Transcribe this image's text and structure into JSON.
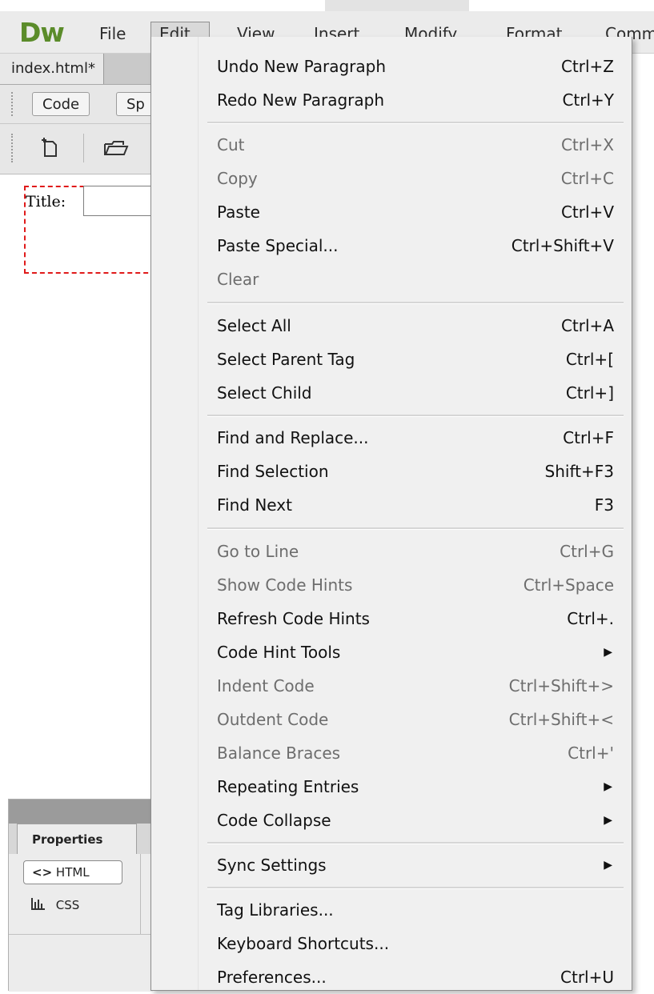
{
  "app": {
    "logo": "Dw"
  },
  "menubar": {
    "items": [
      "File",
      "Edit",
      "View",
      "Insert",
      "Modify",
      "Format",
      "Comm"
    ]
  },
  "document": {
    "tab_label": "index.html*",
    "view_buttons": [
      "Code",
      "Sp"
    ],
    "form_label": "Title:"
  },
  "properties": {
    "tab_label": "Properties",
    "html_button": "HTML",
    "html_glyph": "<>",
    "css_button": "CSS"
  },
  "edit_menu": {
    "items": [
      {
        "label": "Undo New Paragraph",
        "shortcut": "Ctrl+Z",
        "enabled": true
      },
      {
        "label": "Redo New Paragraph",
        "shortcut": "Ctrl+Y",
        "enabled": true
      },
      {
        "label": "Cut",
        "shortcut": "Ctrl+X",
        "enabled": false
      },
      {
        "label": "Copy",
        "shortcut": "Ctrl+C",
        "enabled": false
      },
      {
        "label": "Paste",
        "shortcut": "Ctrl+V",
        "enabled": true
      },
      {
        "label": "Paste Special...",
        "shortcut": "Ctrl+Shift+V",
        "enabled": true
      },
      {
        "label": "Clear",
        "shortcut": "",
        "enabled": false
      },
      {
        "label": "Select All",
        "shortcut": "Ctrl+A",
        "enabled": true
      },
      {
        "label": "Select Parent Tag",
        "shortcut": "Ctrl+[",
        "enabled": true
      },
      {
        "label": "Select Child",
        "shortcut": "Ctrl+]",
        "enabled": true
      },
      {
        "label": "Find and Replace...",
        "shortcut": "Ctrl+F",
        "enabled": true
      },
      {
        "label": "Find Selection",
        "shortcut": "Shift+F3",
        "enabled": true
      },
      {
        "label": "Find Next",
        "shortcut": "F3",
        "enabled": true
      },
      {
        "label": "Go to Line",
        "shortcut": "Ctrl+G",
        "enabled": false
      },
      {
        "label": "Show Code Hints",
        "shortcut": "Ctrl+Space",
        "enabled": false
      },
      {
        "label": "Refresh Code Hints",
        "shortcut": "Ctrl+.",
        "enabled": true
      },
      {
        "label": "Code Hint Tools",
        "shortcut": "",
        "enabled": true,
        "submenu": true
      },
      {
        "label": "Indent Code",
        "shortcut": "Ctrl+Shift+>",
        "enabled": false
      },
      {
        "label": "Outdent Code",
        "shortcut": "Ctrl+Shift+<",
        "enabled": false
      },
      {
        "label": "Balance Braces",
        "shortcut": "Ctrl+'",
        "enabled": false
      },
      {
        "label": "Repeating Entries",
        "shortcut": "",
        "enabled": true,
        "submenu": true
      },
      {
        "label": "Code Collapse",
        "shortcut": "",
        "enabled": true,
        "submenu": true
      },
      {
        "label": "Sync Settings",
        "shortcut": "",
        "enabled": true,
        "submenu": true
      },
      {
        "label": "Tag Libraries...",
        "shortcut": "",
        "enabled": true
      },
      {
        "label": "Keyboard Shortcuts...",
        "shortcut": "",
        "enabled": true
      },
      {
        "label": "Preferences...",
        "shortcut": "Ctrl+U",
        "enabled": true
      }
    ]
  },
  "colors": {
    "logo": "#5b8c2a",
    "disabled_text": "#6d6d6d",
    "form_outline": "#e01a1a"
  }
}
